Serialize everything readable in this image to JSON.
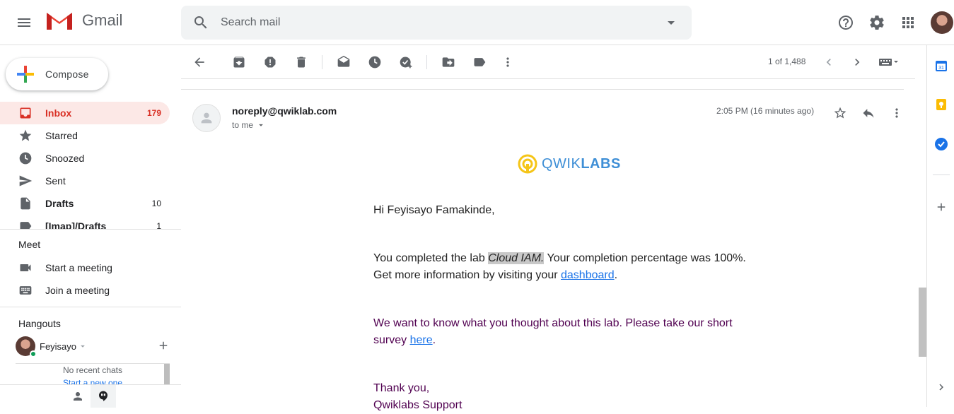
{
  "header": {
    "app_name": "Gmail",
    "search_placeholder": "Search mail"
  },
  "sidebar": {
    "compose_label": "Compose",
    "items": [
      {
        "label": "Inbox",
        "count": "179",
        "icon": "inbox-icon"
      },
      {
        "label": "Starred",
        "count": "",
        "icon": "star-icon"
      },
      {
        "label": "Snoozed",
        "count": "",
        "icon": "clock-icon"
      },
      {
        "label": "Sent",
        "count": "",
        "icon": "send-icon"
      },
      {
        "label": "Drafts",
        "count": "10",
        "icon": "draft-icon"
      },
      {
        "label": "[Imap]/Drafts",
        "count": "1",
        "icon": "label-icon"
      }
    ],
    "meet": {
      "title": "Meet",
      "start": "Start a meeting",
      "join": "Join a meeting"
    },
    "hangouts": {
      "title": "Hangouts",
      "user": "Feyisayo",
      "no_chats": "No recent chats",
      "start_new": "Start a new one"
    }
  },
  "toolbar": {
    "pager": "1 of 1,488"
  },
  "message": {
    "sender": "noreply@qwiklab.com",
    "recipient": "to me",
    "time": "2:05 PM (16 minutes ago)",
    "brand_light": "QWIK",
    "brand_bold": "LABS",
    "greeting": "Hi Feyisayo Famakinde,",
    "line1_prefix": "You completed the lab ",
    "lab_name": "Cloud IAM.",
    "line1_suffix": " Your completion percentage was 100%.",
    "line2_prefix": "Get more information by visiting your ",
    "dashboard_link": "dashboard",
    "line2_suffix": ".",
    "survey_line1": "We want to know what you thought about this lab. Please take our short",
    "survey_prefix": "survey ",
    "survey_link": "here",
    "survey_suffix": ".",
    "thanks": "Thank you,",
    "signature": "Qwiklabs Support"
  }
}
